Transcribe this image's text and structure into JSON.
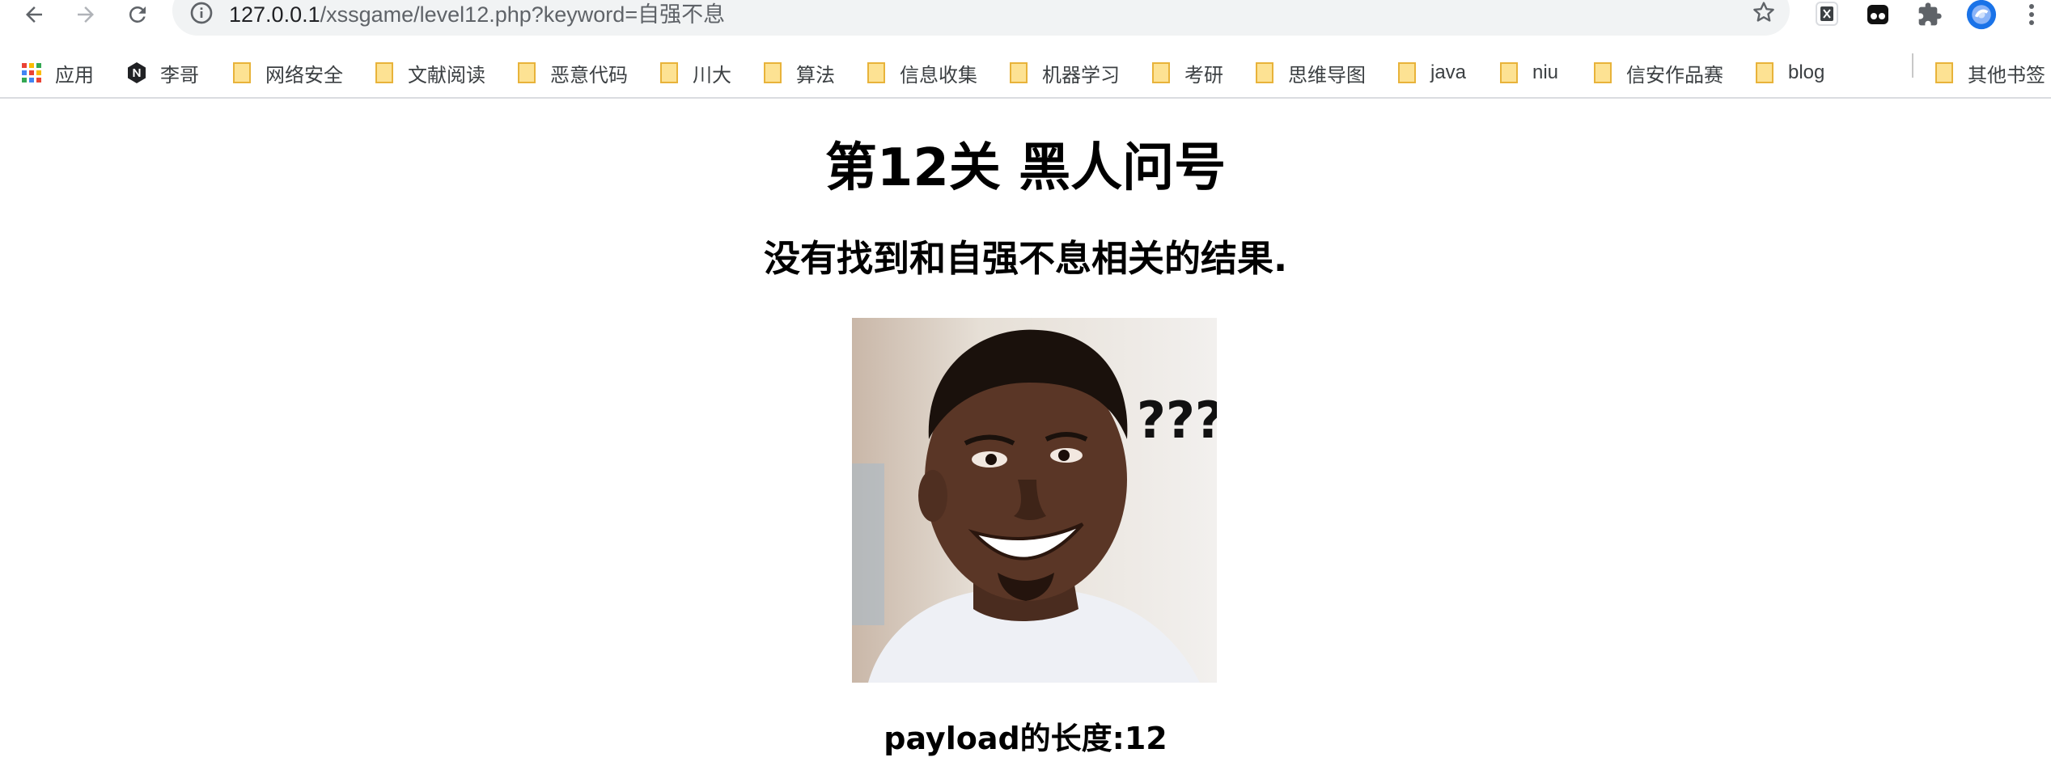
{
  "browser": {
    "url_host": "127.0.0.1",
    "url_rest": "/xssgame/level12.php?keyword=自强不息",
    "extensions": [
      "x-extension-icon",
      "mask-extension-icon",
      "puzzle-icon",
      "profile-avatar"
    ]
  },
  "bookmarks": [
    {
      "label": "应用",
      "icon": "apps-grid-icon"
    },
    {
      "label": "李哥",
      "icon": "n-logo-icon"
    },
    {
      "label": "网络安全",
      "icon": "folder-icon"
    },
    {
      "label": "文献阅读",
      "icon": "folder-icon"
    },
    {
      "label": "恶意代码",
      "icon": "folder-icon"
    },
    {
      "label": "川大",
      "icon": "folder-icon"
    },
    {
      "label": "算法",
      "icon": "folder-icon"
    },
    {
      "label": "信息收集",
      "icon": "folder-icon"
    },
    {
      "label": "机器学习",
      "icon": "folder-icon"
    },
    {
      "label": "考研",
      "icon": "folder-icon"
    },
    {
      "label": "思维导图",
      "icon": "folder-icon"
    },
    {
      "label": "java",
      "icon": "folder-icon"
    },
    {
      "label": "niu",
      "icon": "folder-icon"
    },
    {
      "label": "信安作品赛",
      "icon": "folder-icon"
    },
    {
      "label": "blog",
      "icon": "folder-icon"
    },
    {
      "label": "其他书签",
      "icon": "folder-icon"
    }
  ],
  "page": {
    "title": "第12关 黑人问号",
    "result": "没有找到和自强不息相关的结果.",
    "image_caption": "???",
    "payload_length": "payload的长度:12"
  },
  "colors": {
    "folder": "#f6c344",
    "omnibox_bg": "#f1f3f4",
    "text": "#000000"
  }
}
